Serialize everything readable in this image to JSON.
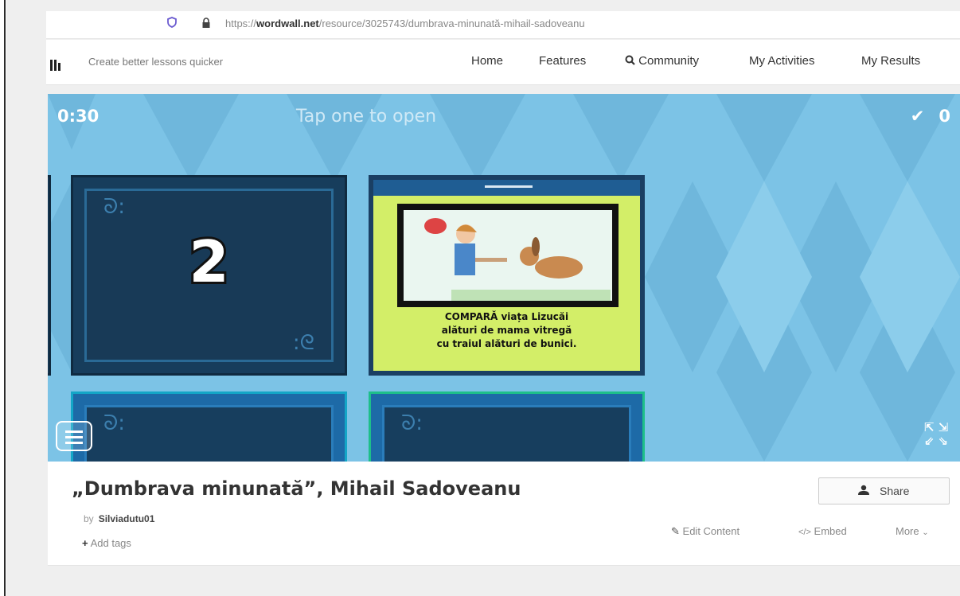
{
  "browser": {
    "url_prefix": "https://",
    "url_host": "wordwall.net",
    "url_path": "/resource/3025743/dumbrava-minunată-mihail-sadoveanu"
  },
  "site": {
    "tagline": "Create better lessons quicker",
    "nav": [
      {
        "label": "Home"
      },
      {
        "label": "Features"
      },
      {
        "label": "Community"
      },
      {
        "label": "My Activities"
      },
      {
        "label": "My Results"
      }
    ]
  },
  "game": {
    "timer": "0:30",
    "instruction": "Tap one to open",
    "score": "0",
    "cards": [
      {
        "state": "closed",
        "number": "2"
      },
      {
        "state": "open",
        "caption_lines": [
          "COMPARĂ viața Lizucăi",
          "alături de mama vitregă",
          "cu traiul alături de bunici."
        ]
      },
      {
        "state": "closed",
        "number": ""
      },
      {
        "state": "closed",
        "number": ""
      }
    ],
    "colors": {
      "background": "#7cc3e6",
      "card": "#173d5c",
      "open_card": "#d3ee68"
    }
  },
  "activity": {
    "title": "„Dumbrava minunată”, Mihail Sadoveanu",
    "by_label": "by",
    "author": "Silviadutu01",
    "add_tags": "Add tags",
    "share": "Share",
    "actions": {
      "edit": "Edit Content",
      "embed": "Embed",
      "more": "More"
    }
  }
}
